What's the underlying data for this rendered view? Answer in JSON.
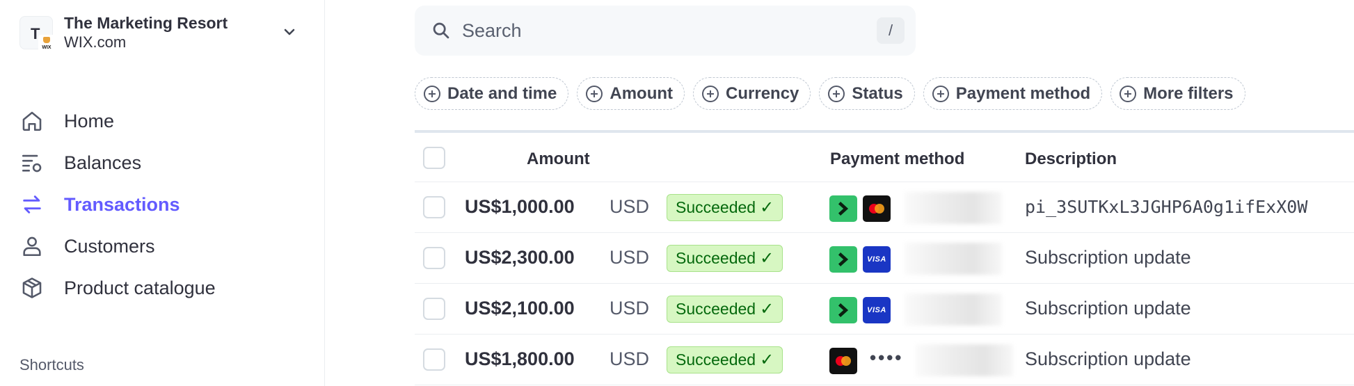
{
  "account": {
    "name": "The Marketing Resort",
    "domain": "WIX.com",
    "avatar_letter": "T",
    "avatar_badge": "WIX"
  },
  "nav": {
    "items": [
      {
        "label": "Home",
        "icon": "home-icon"
      },
      {
        "label": "Balances",
        "icon": "balances-icon"
      },
      {
        "label": "Transactions",
        "icon": "transactions-icon",
        "active": true
      },
      {
        "label": "Customers",
        "icon": "customer-icon"
      },
      {
        "label": "Product catalogue",
        "icon": "box-icon"
      }
    ]
  },
  "shortcuts": {
    "label": "Shortcuts"
  },
  "search": {
    "placeholder": "Search",
    "shortcut": "/"
  },
  "filters": [
    "Date and time",
    "Amount",
    "Currency",
    "Status",
    "Payment method",
    "More filters"
  ],
  "table": {
    "headers": {
      "amount": "Amount",
      "payment_method": "Payment method",
      "description": "Description"
    },
    "rows": [
      {
        "amount": "US$1,000.00",
        "currency": "USD",
        "status": "Succeeded",
        "link": true,
        "card": "mastercard",
        "description": "pi_3SUTKxL3JGHP6A0g1ifExX0W"
      },
      {
        "amount": "US$2,300.00",
        "currency": "USD",
        "status": "Succeeded",
        "link": true,
        "card": "visa",
        "description": "Subscription update"
      },
      {
        "amount": "US$2,100.00",
        "currency": "USD",
        "status": "Succeeded",
        "link": true,
        "card": "visa",
        "description": "Subscription update"
      },
      {
        "amount": "US$1,800.00",
        "currency": "USD",
        "status": "Succeeded",
        "link": false,
        "card": "mastercard",
        "masked_dots": "••••",
        "description": "Subscription update"
      }
    ]
  },
  "colors": {
    "accent": "#635bff",
    "success_bg": "#d7f7c2",
    "success_text": "#05690d",
    "link_green": "#33c16b",
    "visa_blue": "#1a36c4"
  }
}
